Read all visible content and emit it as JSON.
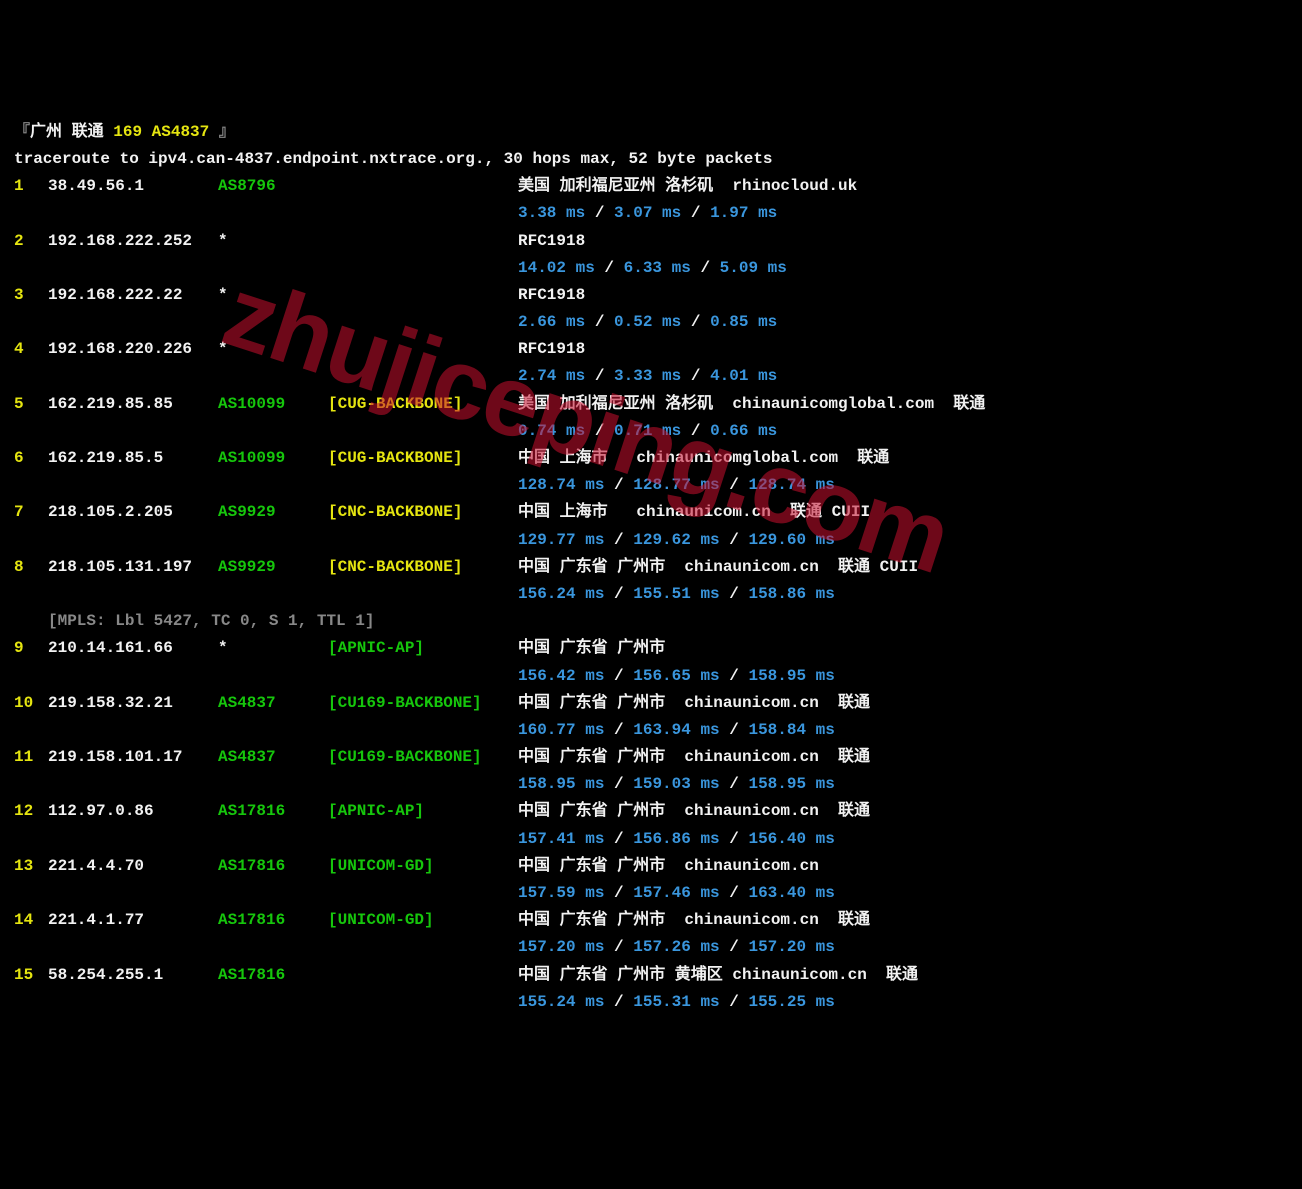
{
  "header": {
    "bracket_open": "『",
    "label": "广州 联通 ",
    "asn_text": "169 AS4837 ",
    "bracket_close": "』"
  },
  "cmdline": "traceroute to ipv4.can-4837.endpoint.nxtrace.org., 30 hops max, 52 byte packets",
  "watermark": "zhujiceping.com",
  "mpls": "[MPLS: Lbl 5427, TC 0, S 1, TTL 1]",
  "hops": [
    {
      "n": "1",
      "ip": "38.49.56.1",
      "asn": "AS8796",
      "net": "",
      "loc": "美国 加利福尼亚州 洛杉矶  rhinocloud.uk",
      "lat": [
        "3.38 ms",
        "3.07 ms",
        "1.97 ms"
      ]
    },
    {
      "n": "2",
      "ip": "192.168.222.252",
      "asn": "*",
      "net": "",
      "loc": "RFC1918",
      "lat": [
        "14.02 ms",
        "6.33 ms",
        "5.09 ms"
      ]
    },
    {
      "n": "3",
      "ip": "192.168.222.22",
      "asn": "*",
      "net": "",
      "loc": "RFC1918",
      "lat": [
        "2.66 ms",
        "0.52 ms",
        "0.85 ms"
      ]
    },
    {
      "n": "4",
      "ip": "192.168.220.226",
      "asn": "*",
      "net": "",
      "loc": "RFC1918",
      "lat": [
        "2.74 ms",
        "3.33 ms",
        "4.01 ms"
      ]
    },
    {
      "n": "5",
      "ip": "162.219.85.85",
      "asn": "AS10099",
      "net": "[CUG-BACKBONE]",
      "loc": "美国 加利福尼亚州 洛杉矶  chinaunicomglobal.com  联通",
      "lat": [
        "0.74 ms",
        "0.71 ms",
        "0.66 ms"
      ]
    },
    {
      "n": "6",
      "ip": "162.219.85.5",
      "asn": "AS10099",
      "net": "[CUG-BACKBONE]",
      "loc": "中国 上海市   chinaunicomglobal.com  联通",
      "lat": [
        "128.74 ms",
        "128.77 ms",
        "128.74 ms"
      ]
    },
    {
      "n": "7",
      "ip": "218.105.2.205",
      "asn": "AS9929",
      "net": "[CNC-BACKBONE]",
      "loc": "中国 上海市   chinaunicom.cn  联通 CUII",
      "lat": [
        "129.77 ms",
        "129.62 ms",
        "129.60 ms"
      ]
    },
    {
      "n": "8",
      "ip": "218.105.131.197",
      "asn": "AS9929",
      "net": "[CNC-BACKBONE]",
      "loc": "中国 广东省 广州市  chinaunicom.cn  联通 CUII",
      "lat": [
        "156.24 ms",
        "155.51 ms",
        "158.86 ms"
      ]
    },
    {
      "n": "9",
      "ip": "210.14.161.66",
      "asn": "*",
      "net": "[APNIC-AP]",
      "loc": "中国 广东省 广州市",
      "lat": [
        "156.42 ms",
        "156.65 ms",
        "158.95 ms"
      ],
      "mpls_before": true
    },
    {
      "n": "10",
      "ip": "219.158.32.21",
      "asn": "AS4837",
      "net": "[CU169-BACKBONE]",
      "loc": "中国 广东省 广州市  chinaunicom.cn  联通",
      "lat": [
        "160.77 ms",
        "163.94 ms",
        "158.84 ms"
      ]
    },
    {
      "n": "11",
      "ip": "219.158.101.17",
      "asn": "AS4837",
      "net": "[CU169-BACKBONE]",
      "loc": "中国 广东省 广州市  chinaunicom.cn  联通",
      "lat": [
        "158.95 ms",
        "159.03 ms",
        "158.95 ms"
      ]
    },
    {
      "n": "12",
      "ip": "112.97.0.86",
      "asn": "AS17816",
      "net": "[APNIC-AP]",
      "loc": "中国 广东省 广州市  chinaunicom.cn  联通",
      "lat": [
        "157.41 ms",
        "156.86 ms",
        "156.40 ms"
      ]
    },
    {
      "n": "13",
      "ip": "221.4.4.70",
      "asn": "AS17816",
      "net": "[UNICOM-GD]",
      "loc": "中国 广东省 广州市  chinaunicom.cn",
      "lat": [
        "157.59 ms",
        "157.46 ms",
        "163.40 ms"
      ]
    },
    {
      "n": "14",
      "ip": "221.4.1.77",
      "asn": "AS17816",
      "net": "[UNICOM-GD]",
      "loc": "中国 广东省 广州市  chinaunicom.cn  联通",
      "lat": [
        "157.20 ms",
        "157.26 ms",
        "157.20 ms"
      ]
    },
    {
      "n": "15",
      "ip": "58.254.255.1",
      "asn": "AS17816",
      "net": "",
      "loc": "中国 广东省 广州市 黄埔区 chinaunicom.cn  联通",
      "lat": [
        "155.24 ms",
        "155.31 ms",
        "155.25 ms"
      ]
    }
  ]
}
